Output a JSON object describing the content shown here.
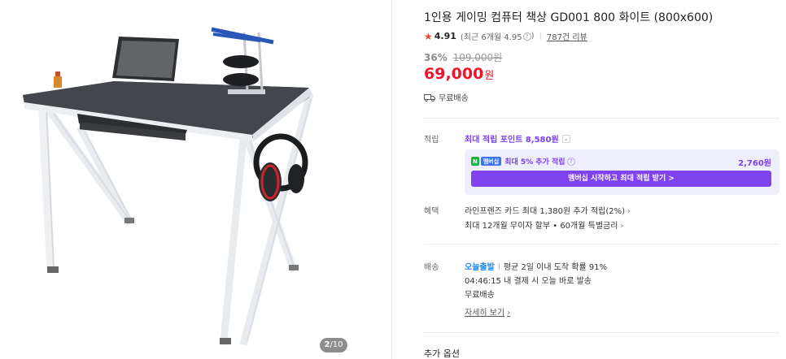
{
  "gallery": {
    "counter_current": "2",
    "counter_total": "/10"
  },
  "product": {
    "title": "1인용 게이밍 컴퓨터 책상 GD001 800 화이트 (800x600)",
    "rating": "4.91",
    "recent_rating": "(최근 6개월 4.95",
    "recent_rating_close": ")",
    "reviews": "787건 리뷰",
    "discount": "36%",
    "original_price": "109,000원",
    "price": "69,000",
    "currency": "원",
    "shipping": "무료배송"
  },
  "points": {
    "label": "적립",
    "max_point": "최대 적립 포인트 8,580원",
    "member_badge_n": "N",
    "member_badge_plus": "멤버십",
    "member_text": "최대 5% 추가 적립",
    "member_amount": "2,760원",
    "member_button": "멤버십 시작하고 최대 적립 받기 >"
  },
  "benefits": {
    "label": "혜택",
    "line1": "라인프렌즈 카드 최대 1,380원 추가 적립(2%)",
    "line2": "최대 12개월 무이자 할부 • 60개월 특별금리"
  },
  "delivery": {
    "label": "배송",
    "today": "오늘출발",
    "arrival": "평균 2일 이내 도착 확률 91%",
    "deadline": "04:46:15  내 결제 시 오늘 바로 발송",
    "shipping": "무료배송",
    "detail_link": "자세히 보기"
  },
  "options": {
    "title": "추가 옵션"
  },
  "colors": {
    "accent": "#f0132a",
    "purple": "#7b3ff2",
    "blue": "#1a8cff",
    "green": "#15b33c"
  }
}
